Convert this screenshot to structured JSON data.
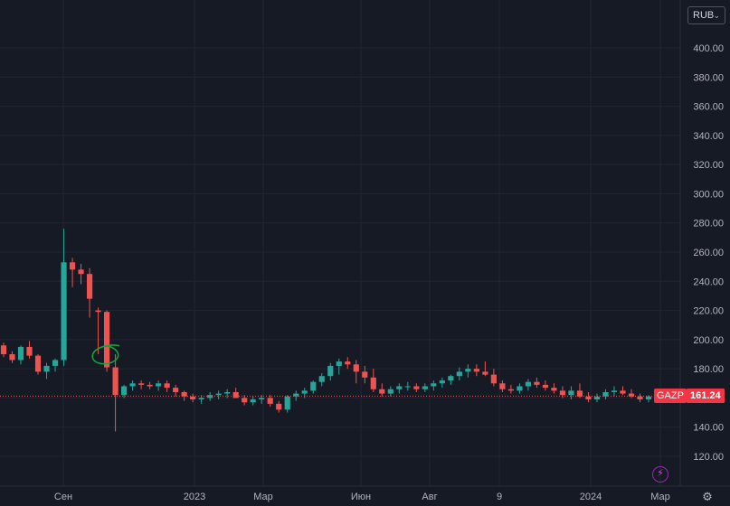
{
  "currency_selector": {
    "label": "RUB",
    "icon": "chevron-down-icon"
  },
  "chart_data": {
    "type": "candlestick",
    "ticker": "GAZP",
    "last_price": "161.24",
    "y_axis": {
      "min": 110,
      "max": 420,
      "ticks": [
        "400.00",
        "380.00",
        "360.00",
        "340.00",
        "320.00",
        "300.00",
        "280.00",
        "260.00",
        "240.00",
        "220.00",
        "200.00",
        "180.00",
        "160.00",
        "140.00",
        "120.00"
      ]
    },
    "x_axis_labels": [
      "Сен",
      "2023",
      "Мар",
      "Июн",
      "Авг",
      "9",
      "2024",
      "Мар"
    ],
    "grid": true,
    "colors": {
      "up": "#26a69a",
      "down": "#ef5350",
      "background": "#161a25",
      "grid": "#232632",
      "axis_text": "#b2b5be",
      "annotation": "#19a23a"
    },
    "candles": [
      [
        196,
        198,
        188,
        190
      ],
      [
        190,
        192,
        184,
        186
      ],
      [
        186,
        196,
        183,
        195
      ],
      [
        195,
        199,
        187,
        189
      ],
      [
        189,
        190,
        176,
        178
      ],
      [
        178,
        184,
        173,
        182
      ],
      [
        182,
        187,
        178,
        186
      ],
      [
        186,
        276,
        182,
        253
      ],
      [
        253,
        256,
        236,
        248
      ],
      [
        248,
        252,
        238,
        245
      ],
      [
        245,
        249,
        215,
        228
      ],
      [
        220,
        222,
        190,
        219
      ],
      [
        219,
        220,
        178,
        181
      ],
      [
        181,
        190,
        137,
        162
      ],
      [
        162,
        169,
        160,
        168
      ],
      [
        168,
        172,
        165,
        170
      ],
      [
        170,
        172,
        166,
        169
      ],
      [
        169,
        171,
        166,
        168
      ],
      [
        168,
        172,
        165,
        170
      ],
      [
        170,
        172,
        164,
        167
      ],
      [
        167,
        169,
        161,
        164
      ],
      [
        164,
        165,
        158,
        161
      ],
      [
        161,
        163,
        157,
        159
      ],
      [
        159,
        162,
        156,
        160
      ],
      [
        160,
        164,
        158,
        162
      ],
      [
        162,
        165,
        159,
        163
      ],
      [
        163,
        166,
        160,
        164
      ],
      [
        164,
        167,
        160,
        160
      ],
      [
        160,
        162,
        155,
        157
      ],
      [
        157,
        161,
        155,
        159
      ],
      [
        159,
        162,
        156,
        160
      ],
      [
        160,
        162,
        154,
        156
      ],
      [
        156,
        158,
        150,
        152
      ],
      [
        152,
        162,
        150,
        161
      ],
      [
        161,
        165,
        158,
        163
      ],
      [
        163,
        167,
        160,
        165
      ],
      [
        165,
        172,
        163,
        171
      ],
      [
        171,
        177,
        168,
        175
      ],
      [
        175,
        184,
        172,
        182
      ],
      [
        182,
        187,
        176,
        185
      ],
      [
        185,
        188,
        180,
        183
      ],
      [
        183,
        186,
        170,
        178
      ],
      [
        178,
        182,
        170,
        174
      ],
      [
        174,
        180,
        164,
        166
      ],
      [
        166,
        170,
        161,
        163
      ],
      [
        163,
        168,
        161,
        166
      ],
      [
        166,
        170,
        163,
        168
      ],
      [
        168,
        171,
        165,
        168
      ],
      [
        168,
        170,
        164,
        166
      ],
      [
        166,
        170,
        164,
        168
      ],
      [
        168,
        172,
        165,
        170
      ],
      [
        170,
        174,
        167,
        172
      ],
      [
        172,
        176,
        169,
        175
      ],
      [
        175,
        181,
        172,
        178
      ],
      [
        178,
        183,
        174,
        180
      ],
      [
        180,
        183,
        175,
        178
      ],
      [
        178,
        185,
        175,
        176
      ],
      [
        176,
        180,
        168,
        170
      ],
      [
        170,
        172,
        164,
        166
      ],
      [
        166,
        169,
        163,
        165
      ],
      [
        165,
        170,
        163,
        168
      ],
      [
        168,
        173,
        165,
        171
      ],
      [
        171,
        174,
        167,
        169
      ],
      [
        169,
        172,
        165,
        167
      ],
      [
        167,
        170,
        163,
        165
      ],
      [
        165,
        168,
        160,
        162
      ],
      [
        162,
        168,
        159,
        165
      ],
      [
        165,
        170,
        160,
        161
      ],
      [
        161,
        164,
        157,
        159
      ],
      [
        159,
        163,
        157,
        161
      ],
      [
        161,
        166,
        159,
        164
      ],
      [
        164,
        168,
        161,
        165
      ],
      [
        165,
        168,
        162,
        163
      ],
      [
        163,
        166,
        160,
        161
      ],
      [
        161,
        163,
        157,
        159
      ],
      [
        159,
        162,
        157,
        161
      ]
    ],
    "annotation": {
      "type": "circle-marker",
      "near_candle_index": 12
    }
  },
  "buttons": {
    "bolt": "bolt-icon",
    "settings": "gear-icon"
  }
}
